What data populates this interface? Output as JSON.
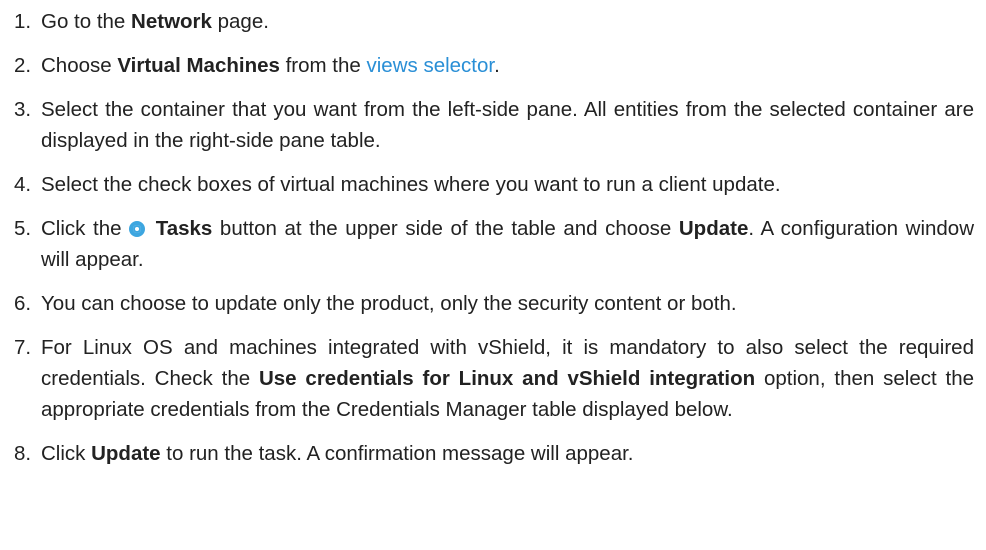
{
  "steps": [
    {
      "num": "1.",
      "parts": [
        {
          "t": "Go to the "
        },
        {
          "t": "Network",
          "b": true
        },
        {
          "t": " page."
        }
      ]
    },
    {
      "num": "2.",
      "parts": [
        {
          "t": "Choose "
        },
        {
          "t": "Virtual Machines",
          "b": true
        },
        {
          "t": " from the "
        },
        {
          "t": "views selector",
          "link": true
        },
        {
          "t": "."
        }
      ]
    },
    {
      "num": "3.",
      "parts": [
        {
          "t": "Select the container that you want from the left-side pane. All entities from the selected container are displayed in the right-side pane table."
        }
      ]
    },
    {
      "num": "4.",
      "parts": [
        {
          "t": "Select the check boxes of virtual machines where you want to run a client update."
        }
      ]
    },
    {
      "num": "5.",
      "parts": [
        {
          "t": "Click the "
        },
        {
          "icon": "tasks-icon"
        },
        {
          "t": " "
        },
        {
          "t": "Tasks",
          "b": true
        },
        {
          "t": " button at the upper side of the table and choose "
        },
        {
          "t": "Update",
          "b": true
        },
        {
          "t": ". A configuration window will appear."
        }
      ]
    },
    {
      "num": "6.",
      "parts": [
        {
          "t": "You can choose to update only the product, only the security content or both."
        }
      ]
    },
    {
      "num": "7.",
      "parts": [
        {
          "t": "For Linux OS and machines integrated with vShield, it is mandatory to also select the required credentials. Check the "
        },
        {
          "t": "Use credentials for Linux and vShield integration",
          "b": true
        },
        {
          "t": " option, then select the appropriate credentials from the Credentials Manager table displayed below."
        }
      ]
    },
    {
      "num": "8.",
      "parts": [
        {
          "t": "Click "
        },
        {
          "t": "Update",
          "b": true
        },
        {
          "t": " to run the task. A confirmation message will appear."
        }
      ]
    }
  ]
}
